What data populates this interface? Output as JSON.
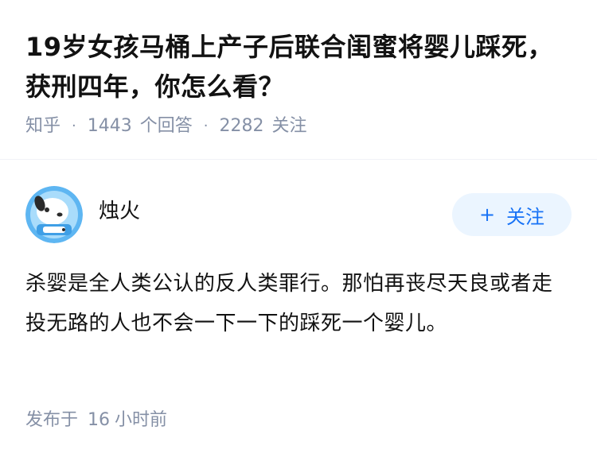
{
  "question": {
    "title": "19岁女孩马桶上产子后联合闺蜜将婴儿踩死，获刑四年，你怎么看？",
    "source": "知乎",
    "separator": "·",
    "answer_count": "1443",
    "answer_label": "个回答",
    "follower_count": "2282",
    "follower_label": "关注"
  },
  "answer": {
    "author_name": "烛火",
    "follow_plus": "+",
    "follow_label": "关注",
    "content": "杀婴是全人类公认的反人类罪行。那怕再丧尽天良或者走投无路的人也不会一下一下的踩死一个婴儿。",
    "publish_prefix": "发布于",
    "publish_number": "16",
    "publish_suffix": "小时前"
  },
  "colors": {
    "title": "#121212",
    "meta": "#8590a6",
    "follow_bg": "#ebf5ff",
    "follow_text": "#1772f6",
    "avatar_bg": "#5eb6f2"
  },
  "icons": {
    "avatar": "dog-avatar-icon"
  }
}
